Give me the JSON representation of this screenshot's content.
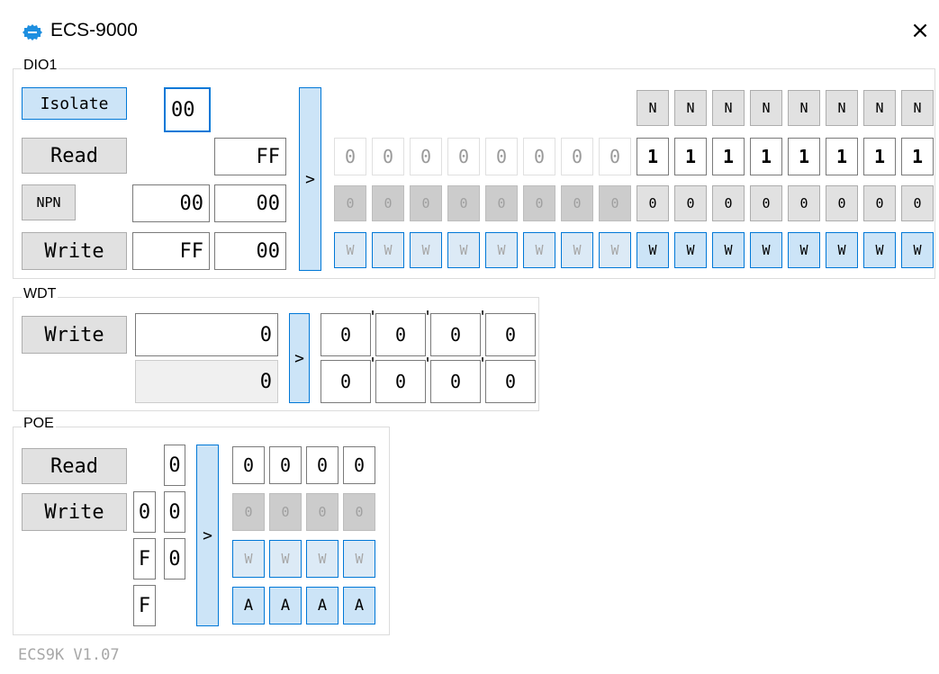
{
  "window": {
    "title": "ECS-9000",
    "close_icon": "×",
    "icon": "app-logo-icon"
  },
  "dio1": {
    "label": "DIO1",
    "isolate_label": "Isolate",
    "isolate_value": "00",
    "read_label": "Read",
    "read_value": "FF",
    "npn_label": "NPN",
    "npn_value_a": "00",
    "npn_value_b": "00",
    "write_label": "Write",
    "write_value_a": "FF",
    "write_value_b": "00",
    "arrow": ">",
    "mode_bits": [
      "N",
      "N",
      "N",
      "N",
      "N",
      "N",
      "N",
      "N"
    ],
    "read_bits": [
      "0",
      "0",
      "0",
      "0",
      "0",
      "0",
      "0",
      "0",
      "1",
      "1",
      "1",
      "1",
      "1",
      "1",
      "1",
      "1"
    ],
    "npn_bits": [
      "0",
      "0",
      "0",
      "0",
      "0",
      "0",
      "0",
      "0",
      "0",
      "0",
      "0",
      "0",
      "0",
      "0",
      "0",
      "0"
    ],
    "write_bits": [
      "W",
      "W",
      "W",
      "W",
      "W",
      "W",
      "W",
      "W",
      "W",
      "W",
      "W",
      "W",
      "W",
      "W",
      "W",
      "W"
    ]
  },
  "wdt": {
    "label": "WDT",
    "write_label": "Write",
    "value_1": "0",
    "value_2": "0",
    "arrow": ">",
    "row1": [
      "0",
      "0",
      "0",
      "0"
    ],
    "row2": [
      "0",
      "0",
      "0",
      "0"
    ],
    "apostrophe": "'"
  },
  "poe": {
    "label": "POE",
    "read_label": "Read",
    "write_label": "Write",
    "read_value": "0",
    "write_value_a": "0",
    "write_value_b": "0",
    "f_value_1": "F",
    "f_value_2": "0",
    "f_value_3": "F",
    "arrow": ">",
    "read_bits": [
      "0",
      "0",
      "0",
      "0"
    ],
    "dis_bits": [
      "0",
      "0",
      "0",
      "0"
    ],
    "write_bits": [
      "W",
      "W",
      "W",
      "W"
    ],
    "a_bits": [
      "A",
      "A",
      "A",
      "A"
    ]
  },
  "footer": {
    "version": "ECS9K V1.07"
  }
}
